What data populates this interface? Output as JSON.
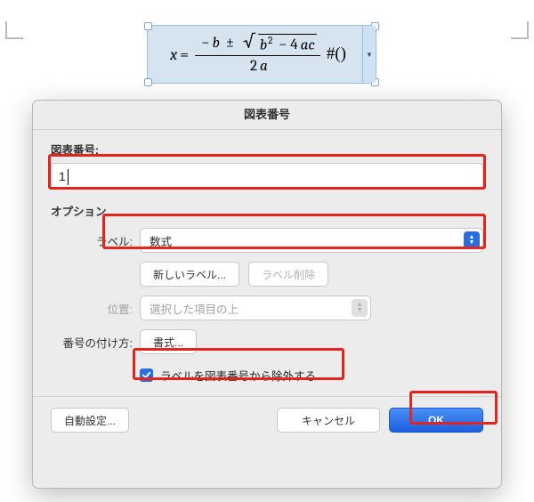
{
  "equation": {
    "lhs_var": "x",
    "eq_sign": "=",
    "minus": "−",
    "b1": "b",
    "pm": "±",
    "sq_exp": "2",
    "minus2": " − 4",
    "a": "a",
    "c": "c",
    "den_two": "2",
    "den_a": "a",
    "tail": "#()"
  },
  "dialog": {
    "title": "図表番号",
    "caption_label": "図表番号:",
    "caption_value": "1",
    "options_label": "オプション",
    "label_key": "ラベル:",
    "label_value": "数式",
    "new_label_btn": "新しいラベル...",
    "delete_label_btn": "ラベル削除",
    "position_key": "位置:",
    "position_value": "選択した項目の上",
    "numbering_key": "番号の付け方:",
    "numbering_btn": "書式...",
    "exclude_label": "ラベルを図表番号から除外する",
    "exclude_checked": true,
    "auto_caption_btn": "自動設定...",
    "cancel_btn": "キャンセル",
    "ok_btn": "OK"
  }
}
